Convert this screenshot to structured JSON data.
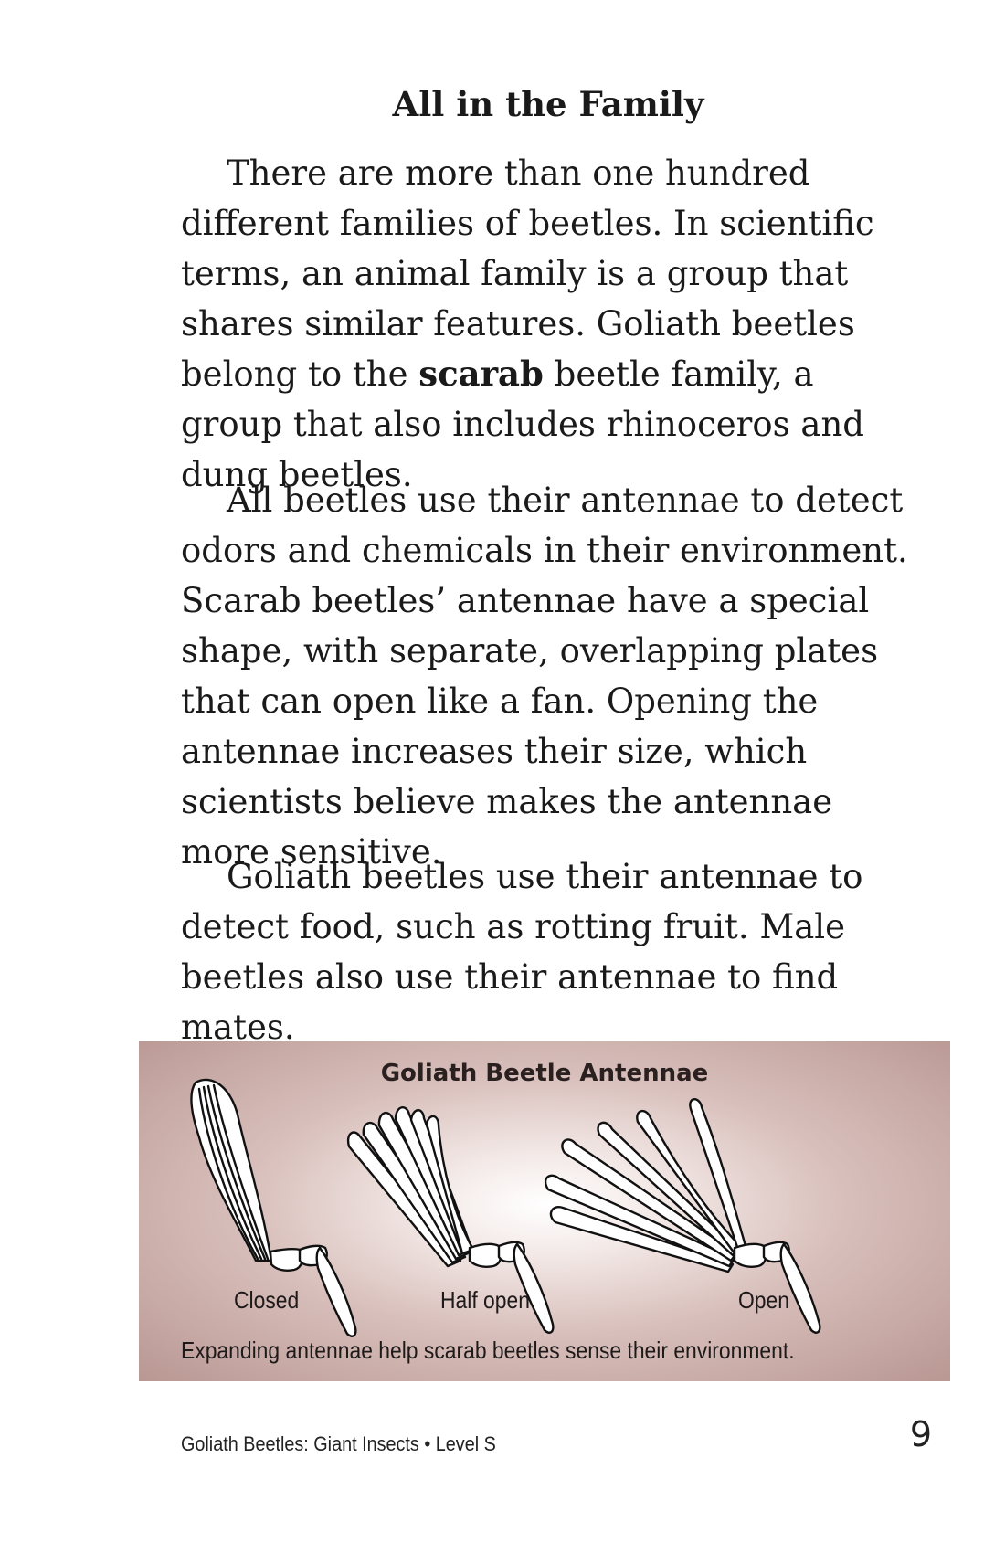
{
  "heading": "All in the Family",
  "paragraphs": {
    "p1_before": "There are more than one hundred different families of beetles. In scientific terms, an animal family is a group that shares similar features. Goliath beetles belong to the ",
    "p1_bold": "scarab",
    "p1_after": " beetle family, a group that also includes rhinoceros and dung beetles.",
    "p2": "All beetles use their antennae to detect odors and chemicals in their environment. Scarab beetles’ antennae have a special shape, with separate, overlapping plates that can open like a fan. Opening the antennae increases their size, which scientists believe makes the antennae more sensitive.",
    "p3": "Goliath beetles use their antennae to detect food, such as rotting fruit. Male beetles also use their antennae to find mates."
  },
  "figure": {
    "title": "Goliath Beetle Antennae",
    "labels": {
      "closed": "Closed",
      "half_open": "Half open",
      "open": "Open"
    },
    "caption": "Expanding antennae help scarab beetles sense their environment."
  },
  "footer": {
    "book_title": "Goliath Beetles: Giant Insects • Level S",
    "page_number": "9"
  }
}
